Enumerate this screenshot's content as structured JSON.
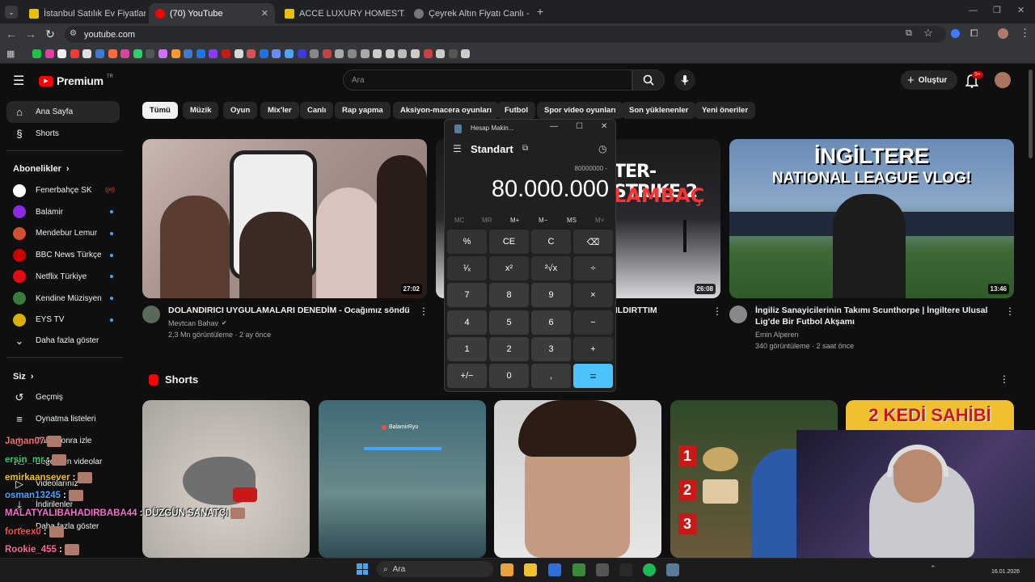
{
  "browser": {
    "tabs": [
      {
        "label": "İstanbul Satılık Ev Fiyatları sahibi",
        "fav_color": "#e8c200"
      },
      {
        "label": "(70) YouTube",
        "fav_color": "#ff0000"
      },
      {
        "label": "ACCE LUXURY HOMES'TAN ME",
        "fav_color": "#e8c200"
      },
      {
        "label": "Çeyrek Altın Fiyatı Canlı - Bugü",
        "fav_color": "#555555"
      }
    ],
    "url": "youtube.com"
  },
  "yt": {
    "logo": "Premium",
    "logo_badge": "TR",
    "search_placeholder": "Ara",
    "create_label": "Oluştur",
    "notif_count": "9+",
    "sidebar": {
      "home": "Ana Sayfa",
      "shorts": "Shorts",
      "subs_header": "Abonelikler",
      "subs": [
        {
          "name": "Fenerbahçe SK",
          "color": "#ffffff",
          "live": true
        },
        {
          "name": "Balamir",
          "color": "#8a2be2",
          "live": false
        },
        {
          "name": "Mendebur Lemur",
          "color": "#d05030",
          "live": false
        },
        {
          "name": "BBC News Türkçe",
          "color": "#cc0000",
          "live": false
        },
        {
          "name": "Netflix Türkiye",
          "color": "#e50914",
          "live": false
        },
        {
          "name": "Kendine Müzisyen",
          "color": "#3a7a3a",
          "live": false
        },
        {
          "name": "EYS TV",
          "color": "#d8b000",
          "live": false
        }
      ],
      "more": "Daha fazla göster",
      "you_header": "Siz",
      "you_items": [
        "Geçmiş",
        "Oynatma listeleri",
        "Daha sonra izle",
        "Beğenilen videolar",
        "Videolarınız",
        "İndirilenler",
        "Daha fazla göster"
      ]
    },
    "chips": [
      "Tümü",
      "Müzik",
      "Oyun",
      "Mix'ler",
      "Canlı",
      "Rap yapma",
      "Aksiyon-macera oyunları",
      "Futbol",
      "Spor video oyunları",
      "Son yüklenenler",
      "Yeni öneriler"
    ],
    "videos": [
      {
        "title": "DOLANDIRICI UYGULAMALARI DENEDİM - Ocağımız söndü",
        "channel": "Mevtcan Bahav",
        "meta": "2,3 Mn görüntüleme · 2 ay önce",
        "duration": "27:02"
      },
      {
        "title": "...ILDIRTTIM",
        "channel": "",
        "meta": "",
        "duration": "26:08",
        "thumb_text_a": "TER-STRIKE 2",
        "thumb_text_b": "LAMBAÇ"
      },
      {
        "title": "İngiliz Sanayicilerinin Takımı Scunthorpe | İngiltere Ulusal Lig'de Bir Futbol Akşamı",
        "channel": "Emin Alperen",
        "meta": "340 görüntüleme · 2 saat önce",
        "duration": "13:46",
        "thumb_text_a": "İNGİLTERE",
        "thumb_text_b": "NATIONAL LEAGUE VLOG!"
      }
    ],
    "shorts_title": "Shorts",
    "short_overlay_text": "2 KEDİ SAHİBİ",
    "short_overlay_text2": "DÜZGÜN SANATÇI",
    "short_mini_label": "BalamirRyo"
  },
  "calculator": {
    "window_title": "Hesap Makin...",
    "mode": "Standart",
    "expression": "80000000 -",
    "display": "80.000.000",
    "memory": [
      "MC",
      "MR",
      "M+",
      "M−",
      "MS",
      "M˅"
    ],
    "keys": [
      [
        "%",
        "CE",
        "C",
        "⌫"
      ],
      [
        "¹⁄ₓ",
        "x²",
        "²√x",
        "÷"
      ],
      [
        "7",
        "8",
        "9",
        "×"
      ],
      [
        "4",
        "5",
        "6",
        "−"
      ],
      [
        "1",
        "2",
        "3",
        "+"
      ],
      [
        "+/−",
        "0",
        ",",
        "="
      ]
    ]
  },
  "chat": [
    {
      "user": "Jaman07",
      "text": "",
      "color": "#ff6b6b"
    },
    {
      "user": "ersin_mr",
      "text": ":",
      "color": "#2ecc71"
    },
    {
      "user": "emirkaansever",
      "text": ":",
      "color": "#f1c40f"
    },
    {
      "user": "osman13245",
      "text": ":",
      "color": "#4aa3ff"
    },
    {
      "user": "MALATYALIBAHADIRBABA44",
      "text": ": DÜZGÜN SANATÇI",
      "color": "#ff6bd0"
    },
    {
      "user": "forteex0",
      "text": ":",
      "color": "#ff4d4d"
    },
    {
      "user": "Rookie_455",
      "text": ":",
      "color": "#ff6b9a"
    }
  ],
  "taskbar": {
    "search": "Ara",
    "date": "16.01.2026"
  }
}
